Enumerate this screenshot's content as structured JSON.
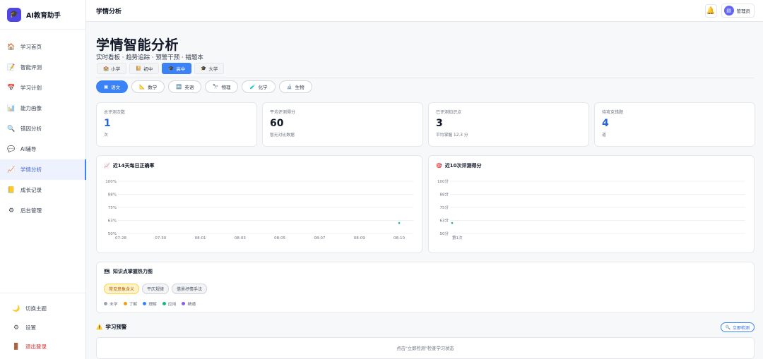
{
  "app": {
    "name": "AI教育助手",
    "logo_icon": "graduation-cap-icon"
  },
  "sidebar": {
    "items": [
      {
        "label": "学习首页",
        "icon": "home-icon",
        "glyph": "🏠",
        "active": false
      },
      {
        "label": "智能评测",
        "icon": "memo-icon",
        "glyph": "📝",
        "active": false
      },
      {
        "label": "学习计划",
        "icon": "calendar-icon",
        "glyph": "📅",
        "active": false
      },
      {
        "label": "能力画像",
        "icon": "bar-chart-icon",
        "glyph": "📊",
        "active": false
      },
      {
        "label": "错因分析",
        "icon": "magnifier-icon",
        "glyph": "🔍",
        "active": false
      },
      {
        "label": "AI辅导",
        "icon": "chat-icon",
        "glyph": "💬",
        "active": false
      },
      {
        "label": "学情分析",
        "icon": "trend-chart-icon",
        "glyph": "📈",
        "active": true
      },
      {
        "label": "成长记录",
        "icon": "notebook-icon",
        "glyph": "📒",
        "active": false
      },
      {
        "label": "后台管理",
        "icon": "gear-icon",
        "glyph": "⚙",
        "active": false
      }
    ],
    "bottom": {
      "theme": "切换主题",
      "settings": "设置",
      "logout": "退出登录"
    }
  },
  "topbar": {
    "title": "学情分析",
    "user": "管理员"
  },
  "page": {
    "title": "学情智能分析",
    "subtitle": "实时看板 · 趋势追踪 · 预警干预 · 错题本"
  },
  "levels": [
    {
      "label": "小学",
      "glyph": "🏫",
      "active": false
    },
    {
      "label": "初中",
      "glyph": "📔",
      "active": false
    },
    {
      "label": "高中",
      "glyph": "🎓",
      "active": true
    },
    {
      "label": "大学",
      "glyph": "🎓",
      "active": false
    }
  ],
  "subjects": [
    {
      "label": "语文",
      "glyph": "▣",
      "active": true
    },
    {
      "label": "数学",
      "glyph": "📐",
      "active": false
    },
    {
      "label": "英语",
      "glyph": "🔤",
      "active": false
    },
    {
      "label": "物理",
      "glyph": "🔭",
      "active": false
    },
    {
      "label": "化学",
      "glyph": "🧪",
      "active": false
    },
    {
      "label": "生物",
      "glyph": "🔬",
      "active": false
    }
  ],
  "stats": [
    {
      "label": "总评测次数",
      "value": "1",
      "note": "次",
      "color": "blue"
    },
    {
      "label": "平均评测得分",
      "value": "60",
      "note": "暂无对比数据",
      "color": "dark"
    },
    {
      "label": "已评测知识点",
      "value": "3",
      "note": "平均掌握 12.3 分",
      "color": "dark"
    },
    {
      "label": "待攻克错题",
      "value": "4",
      "note": "道",
      "color": "blue"
    }
  ],
  "charts": {
    "accuracy_title": "近14天每日正确率",
    "score_title": "近10次评测得分"
  },
  "chart_data": [
    {
      "type": "line",
      "title": "近14天每日正确率",
      "x": [
        "07-28",
        "07-30",
        "08-01",
        "08-03",
        "08-05",
        "08-07",
        "08-09",
        "08-10"
      ],
      "y_ticks": [
        "100%",
        "88%",
        "75%",
        "63%",
        "50%"
      ],
      "ylim": [
        50,
        100
      ],
      "series": [
        {
          "values": [
            null,
            null,
            null,
            null,
            null,
            null,
            null,
            60
          ]
        }
      ],
      "color": "#14b8a6"
    },
    {
      "type": "line",
      "title": "近10次评测得分",
      "x": [
        "第1次"
      ],
      "y_ticks": [
        "100分",
        "88分",
        "75分",
        "63分",
        "50分"
      ],
      "ylim": [
        50,
        100
      ],
      "series": [
        {
          "values": [
            60
          ]
        }
      ],
      "color": "#14b8a6"
    }
  ],
  "heatmap": {
    "title": "知识点掌握热力图",
    "tags": [
      {
        "label": "常见意象含义",
        "hot": true
      },
      {
        "label": "平仄规律",
        "hot": false
      },
      {
        "label": "借景抒情手法",
        "hot": false
      }
    ],
    "legend": [
      {
        "label": "未学",
        "color": "#9ca3af"
      },
      {
        "label": "了解",
        "color": "#f59e0b"
      },
      {
        "label": "理解",
        "color": "#3b82f6"
      },
      {
        "label": "应用",
        "color": "#10b981"
      },
      {
        "label": "精通",
        "color": "#8b5cf6"
      }
    ]
  },
  "warning": {
    "title": "学习预警",
    "button": "立即检测",
    "hint": "点击\"立即检测\"检查学习状态"
  }
}
